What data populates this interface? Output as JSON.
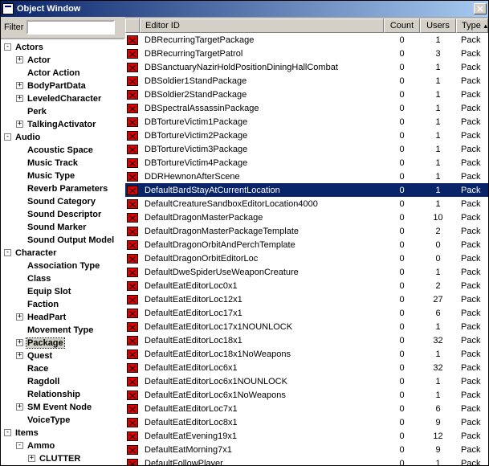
{
  "window": {
    "title": "Object Window"
  },
  "filter": {
    "label": "Filter",
    "value": ""
  },
  "columns": {
    "editor_id": "Editor ID",
    "count": "Count",
    "users": "Users",
    "type": "Type"
  },
  "tree": [
    {
      "label": "Actors",
      "exp": true,
      "indent": 0,
      "toggle": "-",
      "children": [
        {
          "label": "Actor",
          "indent": 1,
          "toggle": "+"
        },
        {
          "label": "Actor Action",
          "indent": 1,
          "toggle": ""
        },
        {
          "label": "BodyPartData",
          "indent": 1,
          "toggle": "+"
        },
        {
          "label": "LeveledCharacter",
          "indent": 1,
          "toggle": "+"
        },
        {
          "label": "Perk",
          "indent": 1,
          "toggle": ""
        },
        {
          "label": "TalkingActivator",
          "indent": 1,
          "toggle": "+"
        }
      ]
    },
    {
      "label": "Audio",
      "exp": true,
      "indent": 0,
      "toggle": "-",
      "children": [
        {
          "label": "Acoustic Space",
          "indent": 1,
          "toggle": ""
        },
        {
          "label": "Music Track",
          "indent": 1,
          "toggle": ""
        },
        {
          "label": "Music Type",
          "indent": 1,
          "toggle": ""
        },
        {
          "label": "Reverb Parameters",
          "indent": 1,
          "toggle": ""
        },
        {
          "label": "Sound Category",
          "indent": 1,
          "toggle": ""
        },
        {
          "label": "Sound Descriptor",
          "indent": 1,
          "toggle": ""
        },
        {
          "label": "Sound Marker",
          "indent": 1,
          "toggle": ""
        },
        {
          "label": "Sound Output Model",
          "indent": 1,
          "toggle": ""
        }
      ]
    },
    {
      "label": "Character",
      "exp": true,
      "indent": 0,
      "toggle": "-",
      "children": [
        {
          "label": "Association Type",
          "indent": 1,
          "toggle": ""
        },
        {
          "label": "Class",
          "indent": 1,
          "toggle": ""
        },
        {
          "label": "Equip Slot",
          "indent": 1,
          "toggle": ""
        },
        {
          "label": "Faction",
          "indent": 1,
          "toggle": ""
        },
        {
          "label": "HeadPart",
          "indent": 1,
          "toggle": "+"
        },
        {
          "label": "Movement Type",
          "indent": 1,
          "toggle": ""
        },
        {
          "label": "Package",
          "indent": 1,
          "toggle": "+",
          "selected": true
        },
        {
          "label": "Quest",
          "indent": 1,
          "toggle": "+"
        },
        {
          "label": "Race",
          "indent": 1,
          "toggle": ""
        },
        {
          "label": "Ragdoll",
          "indent": 1,
          "toggle": ""
        },
        {
          "label": "Relationship",
          "indent": 1,
          "toggle": ""
        },
        {
          "label": "SM Event Node",
          "indent": 1,
          "toggle": "+"
        },
        {
          "label": "VoiceType",
          "indent": 1,
          "toggle": ""
        }
      ]
    },
    {
      "label": "Items",
      "exp": true,
      "indent": 0,
      "toggle": "-",
      "children": [
        {
          "label": "Ammo",
          "indent": 1,
          "toggle": "-",
          "children": [
            {
              "label": "CLUTTER",
              "indent": 2,
              "toggle": "+"
            }
          ]
        }
      ]
    }
  ],
  "rows": [
    {
      "id": "DBRecurringTargetPackage",
      "count": 0,
      "users": 1,
      "type": "Pack"
    },
    {
      "id": "DBRecurringTargetPatrol",
      "count": 0,
      "users": 3,
      "type": "Pack"
    },
    {
      "id": "DBSanctuaryNazirHoldPositionDiningHallCombat",
      "count": 0,
      "users": 1,
      "type": "Pack"
    },
    {
      "id": "DBSoldier1StandPackage",
      "count": 0,
      "users": 1,
      "type": "Pack"
    },
    {
      "id": "DBSoldier2StandPackage",
      "count": 0,
      "users": 1,
      "type": "Pack"
    },
    {
      "id": "DBSpectralAssassinPackage",
      "count": 0,
      "users": 1,
      "type": "Pack"
    },
    {
      "id": "DBTortureVictim1Package",
      "count": 0,
      "users": 1,
      "type": "Pack"
    },
    {
      "id": "DBTortureVictim2Package",
      "count": 0,
      "users": 1,
      "type": "Pack"
    },
    {
      "id": "DBTortureVictim3Package",
      "count": 0,
      "users": 1,
      "type": "Pack"
    },
    {
      "id": "DBTortureVictim4Package",
      "count": 0,
      "users": 1,
      "type": "Pack"
    },
    {
      "id": "DDRHewnonAfterScene",
      "count": 0,
      "users": 1,
      "type": "Pack"
    },
    {
      "id": "DefaultBardStayAtCurrentLocation",
      "count": 0,
      "users": 1,
      "type": "Pack",
      "selected": true
    },
    {
      "id": "DefaultCreatureSandboxEditorLocation4000",
      "count": 0,
      "users": 1,
      "type": "Pack"
    },
    {
      "id": "DefaultDragonMasterPackage",
      "count": 0,
      "users": 10,
      "type": "Pack"
    },
    {
      "id": "DefaultDragonMasterPackageTemplate",
      "count": 0,
      "users": 2,
      "type": "Pack"
    },
    {
      "id": "DefaultDragonOrbitAndPerchTemplate",
      "count": 0,
      "users": 0,
      "type": "Pack"
    },
    {
      "id": "DefaultDragonOrbitEditorLoc",
      "count": 0,
      "users": 0,
      "type": "Pack"
    },
    {
      "id": "DefaultDweSpiderUseWeaponCreature",
      "count": 0,
      "users": 1,
      "type": "Pack"
    },
    {
      "id": "DefaultEatEditorLoc0x1",
      "count": 0,
      "users": 2,
      "type": "Pack"
    },
    {
      "id": "DefaultEatEditorLoc12x1",
      "count": 0,
      "users": 27,
      "type": "Pack"
    },
    {
      "id": "DefaultEatEditorLoc17x1",
      "count": 0,
      "users": 6,
      "type": "Pack"
    },
    {
      "id": "DefaultEatEditorLoc17x1NOUNLOCK",
      "count": 0,
      "users": 1,
      "type": "Pack"
    },
    {
      "id": "DefaultEatEditorLoc18x1",
      "count": 0,
      "users": 32,
      "type": "Pack"
    },
    {
      "id": "DefaultEatEditorLoc18x1NoWeapons",
      "count": 0,
      "users": 1,
      "type": "Pack"
    },
    {
      "id": "DefaultEatEditorLoc6x1",
      "count": 0,
      "users": 32,
      "type": "Pack"
    },
    {
      "id": "DefaultEatEditorLoc6x1NOUNLOCK",
      "count": 0,
      "users": 1,
      "type": "Pack"
    },
    {
      "id": "DefaultEatEditorLoc6x1NoWeapons",
      "count": 0,
      "users": 1,
      "type": "Pack"
    },
    {
      "id": "DefaultEatEditorLoc7x1",
      "count": 0,
      "users": 6,
      "type": "Pack"
    },
    {
      "id": "DefaultEatEditorLoc8x1",
      "count": 0,
      "users": 9,
      "type": "Pack"
    },
    {
      "id": "DefaultEatEvening19x1",
      "count": 0,
      "users": 12,
      "type": "Pack"
    },
    {
      "id": "DefaultEatMorning7x1",
      "count": 0,
      "users": 9,
      "type": "Pack"
    },
    {
      "id": "DefaultFollowPlayer",
      "count": 0,
      "users": 1,
      "type": "Pack"
    }
  ]
}
